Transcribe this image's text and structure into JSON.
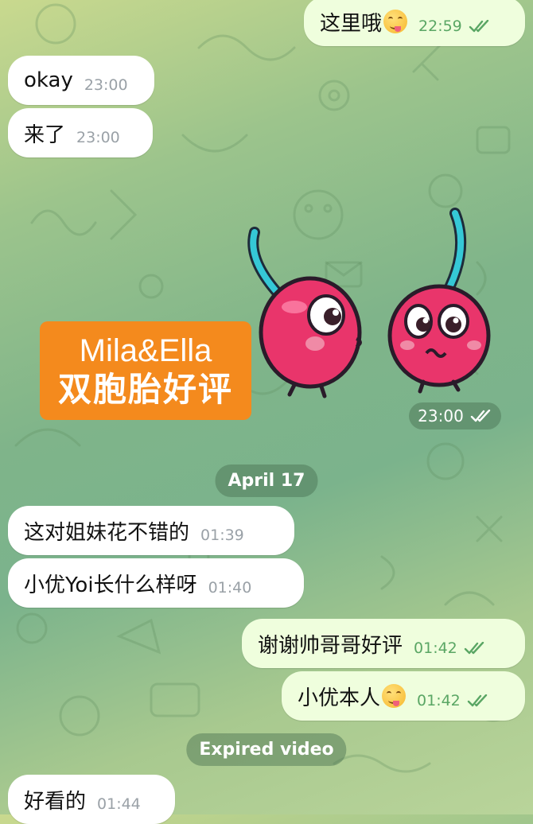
{
  "messages": [
    {
      "side": "out",
      "text": "这里哦",
      "emoji": "savoring-face-emoji",
      "time": "22:59",
      "read": true
    },
    {
      "side": "in",
      "text": "okay",
      "time": "23:00"
    },
    {
      "side": "in",
      "text": "来了",
      "time": "23:00"
    },
    {
      "side": "in",
      "text": "这对姐妹花不错的",
      "time": "01:39"
    },
    {
      "side": "in",
      "text": "小优Yoi长什么样呀",
      "time": "01:40"
    },
    {
      "side": "out",
      "text": "谢谢帅哥哥好评",
      "time": "01:42",
      "read": true
    },
    {
      "side": "out",
      "text": "小优本人",
      "emoji": "savoring-face-emoji",
      "time": "01:42",
      "read": true
    },
    {
      "side": "in",
      "text": "好看的",
      "time": "01:44"
    }
  ],
  "sticker": {
    "promo_line1": "Mila&Ella",
    "promo_line2": "双胞胎好评",
    "time": "23:00",
    "icon": "cherry-twins-sticker"
  },
  "date_separator": "April 17",
  "expired_video": "Expired video",
  "colors": {
    "incoming_bubble": "#ffffff",
    "outgoing_bubble": "#effedd",
    "read_check": "#5aa664",
    "promo": "#f48a1d",
    "cherry": "#e9356b"
  }
}
